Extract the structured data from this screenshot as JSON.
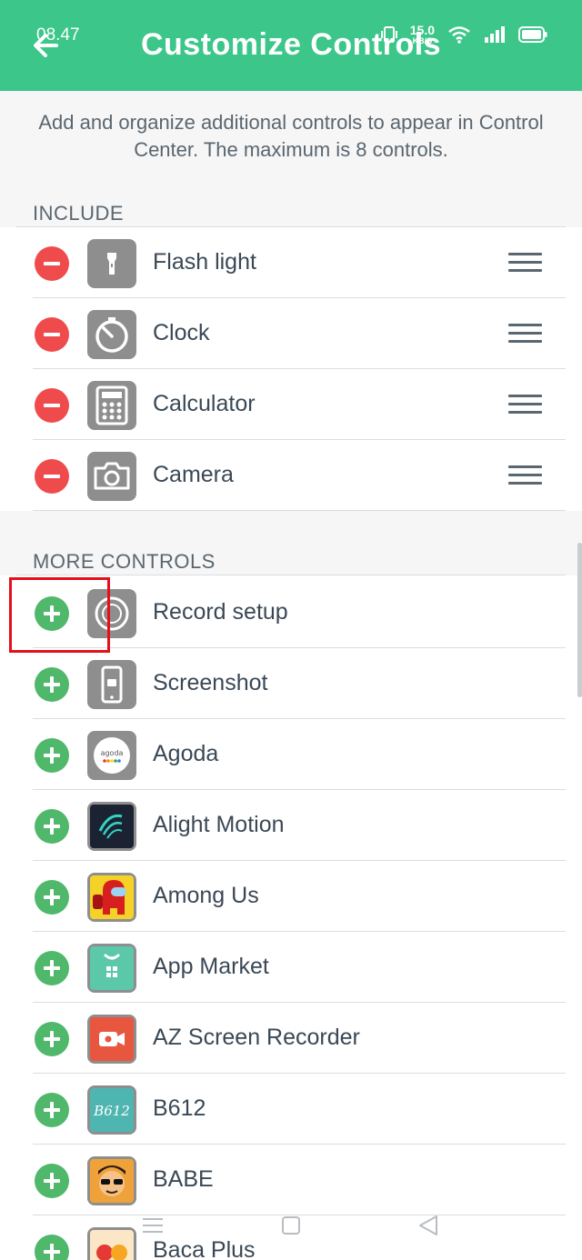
{
  "status_bar": {
    "time": "08.47",
    "net_speed_value": "15.0",
    "net_speed_unit": "KB/S"
  },
  "header": {
    "title": "Customize Controls"
  },
  "description": "Add and organize additional controls to appear in Control Center. The maximum is 8 controls.",
  "include": {
    "heading": "INCLUDE",
    "items": [
      {
        "label": "Flash light",
        "icon": "flashlight-icon"
      },
      {
        "label": "Clock",
        "icon": "clock-icon"
      },
      {
        "label": "Calculator",
        "icon": "calculator-icon"
      },
      {
        "label": "Camera",
        "icon": "camera-icon"
      }
    ]
  },
  "more": {
    "heading": "MORE CONTROLS",
    "items": [
      {
        "label": "Record setup",
        "icon": "record-icon"
      },
      {
        "label": "Screenshot",
        "icon": "screenshot-icon"
      },
      {
        "label": "Agoda",
        "icon": "agoda-icon",
        "icon_text": "agoda"
      },
      {
        "label": "Alight Motion",
        "icon": "alight-motion-icon"
      },
      {
        "label": "Among Us",
        "icon": "among-us-icon"
      },
      {
        "label": "App Market",
        "icon": "app-market-icon"
      },
      {
        "label": "AZ Screen Recorder",
        "icon": "az-recorder-icon"
      },
      {
        "label": "B612",
        "icon": "b612-icon",
        "icon_text": "B612"
      },
      {
        "label": "BABE",
        "icon": "babe-icon"
      },
      {
        "label": "Baca Plus",
        "icon": "baca-plus-icon"
      }
    ]
  },
  "colors": {
    "header": "#3cc68a",
    "remove": "#ef4b4d",
    "add": "#4fb86b",
    "highlight": "#e3101c"
  }
}
